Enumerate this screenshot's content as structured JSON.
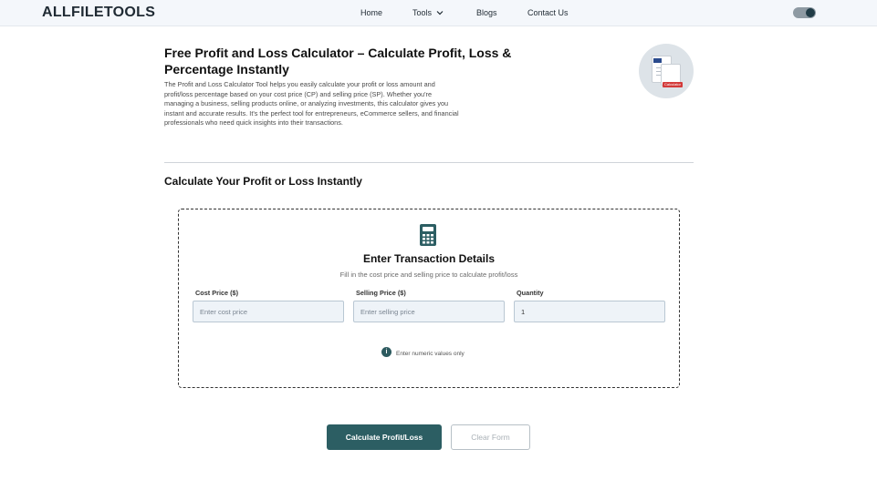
{
  "header": {
    "logo": "ALLFILETOOLS",
    "nav": {
      "home": "Home",
      "tools": "Tools",
      "blogs": "Blogs",
      "contact": "Contact Us"
    },
    "theme_toggle": {
      "state": "on"
    }
  },
  "intro": {
    "title": "Free Profit and Loss Calculator – Calculate Profit, Loss & Percentage Instantly",
    "description": "The Profit and Loss Calculator Tool helps you easily calculate your profit or loss amount and profit/loss percentage based on your cost price (CP) and selling price (SP). Whether you're managing a business, selling products online, or analyzing investments, this calculator gives you instant and accurate results. It's the perfect tool for entrepreneurs, eCommerce sellers, and financial professionals who need quick insights into their transactions.",
    "hero_image": {
      "doc_tag": "PNG",
      "badge": "Calculator"
    }
  },
  "section_title": "Calculate Your Profit or Loss Instantly",
  "card": {
    "title": "Enter Transaction Details",
    "subtitle": "Fill in the cost price and selling price to calculate profit/loss",
    "fields": {
      "cost_price": {
        "label": "Cost Price ($)",
        "placeholder": "Enter cost price",
        "value": ""
      },
      "selling_price": {
        "label": "Selling Price ($)",
        "placeholder": "Enter selling price",
        "value": ""
      },
      "quantity": {
        "label": "Quantity",
        "placeholder": "",
        "value": "1"
      }
    },
    "hint": "Enter numeric values only",
    "hint_icon": "info-icon"
  },
  "actions": {
    "calculate": "Calculate Profit/Loss",
    "clear": "Clear Form"
  },
  "colors": {
    "primary": "#2c5e63",
    "header_bg": "#f4f7fb",
    "input_bg": "#eef3f8"
  }
}
